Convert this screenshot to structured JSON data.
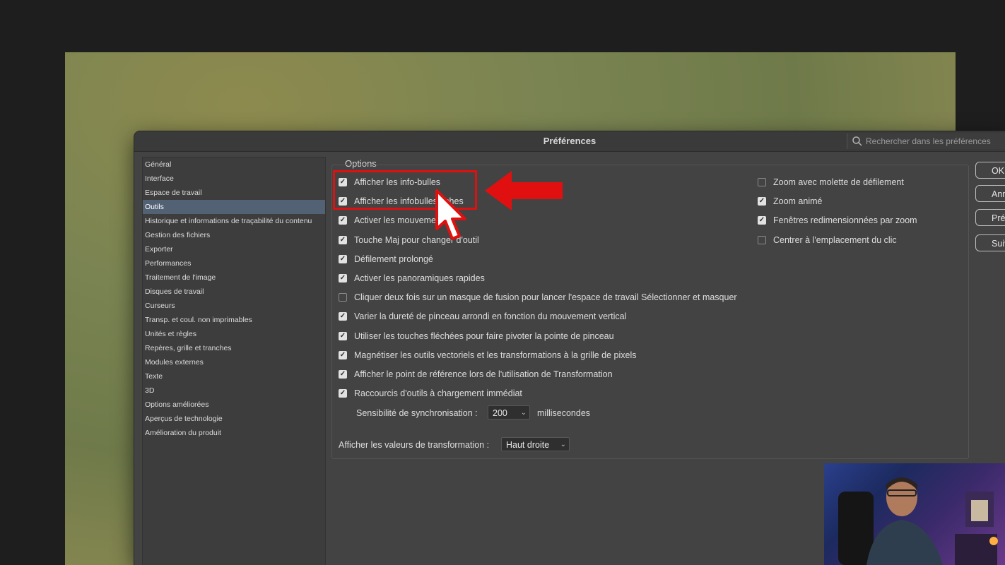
{
  "dialog": {
    "title": "Préférences",
    "search_placeholder": "Rechercher dans les préférences"
  },
  "sidebar": {
    "items": [
      {
        "label": "Général"
      },
      {
        "label": "Interface"
      },
      {
        "label": "Espace de travail"
      },
      {
        "label": "Outils",
        "selected": true
      },
      {
        "label": "Historique et informations de traçabilité du contenu"
      },
      {
        "label": "Gestion des fichiers"
      },
      {
        "label": "Exporter"
      },
      {
        "label": "Performances"
      },
      {
        "label": "Traitement de l'image"
      },
      {
        "label": "Disques de travail"
      },
      {
        "label": "Curseurs"
      },
      {
        "label": "Transp. et coul. non imprimables"
      },
      {
        "label": "Unités et règles"
      },
      {
        "label": "Repères, grille et tranches"
      },
      {
        "label": "Modules externes"
      },
      {
        "label": "Texte"
      },
      {
        "label": "3D"
      },
      {
        "label": "Options améliorées"
      },
      {
        "label": "Aperçus de technologie"
      },
      {
        "label": "Amélioration du produit"
      }
    ]
  },
  "options": {
    "label": "Options",
    "left_column": [
      {
        "label": "Afficher les info-bulles",
        "checked": true
      },
      {
        "label": "Afficher les infobulles riches",
        "checked": true
      },
      {
        "label": "Activer les mouvements",
        "checked": true
      },
      {
        "label": "Touche Maj pour changer d'outil",
        "checked": true
      },
      {
        "label": "Défilement prolongé",
        "checked": true
      },
      {
        "label": "Activer les panoramiques rapides",
        "checked": true
      },
      {
        "label": "Cliquer deux fois sur un masque de fusion pour lancer l'espace de travail Sélectionner et masquer",
        "checked": false
      },
      {
        "label": "Varier la dureté de pinceau arrondi en fonction du mouvement vertical",
        "checked": true
      },
      {
        "label": "Utiliser les touches fléchées pour faire pivoter la pointe de pinceau",
        "checked": true
      },
      {
        "label": "Magnétiser les outils vectoriels et les transformations à la grille de pixels",
        "checked": true
      },
      {
        "label": "Afficher le point de référence lors de l'utilisation de Transformation",
        "checked": true
      },
      {
        "label": "Raccourcis d'outils à chargement immédiat",
        "checked": true
      }
    ],
    "right_column": [
      {
        "label": "Zoom avec molette de défilement",
        "checked": false
      },
      {
        "label": "Zoom animé",
        "checked": true
      },
      {
        "label": "Fenêtres redimensionnées par zoom",
        "checked": true
      },
      {
        "label": "Centrer à l'emplacement du clic",
        "checked": false
      }
    ],
    "sync": {
      "label": "Sensibilité de synchronisation :",
      "value": "200",
      "unit": "millisecondes"
    },
    "transform_values": {
      "label": "Afficher les valeurs de transformation :",
      "value": "Haut droite"
    }
  },
  "buttons": {
    "ok": "OK",
    "cancel": "Annuler",
    "prev": "Précédent",
    "next": "Suivant"
  },
  "colors": {
    "highlight": "#e01010",
    "selected_item": "#526174"
  }
}
